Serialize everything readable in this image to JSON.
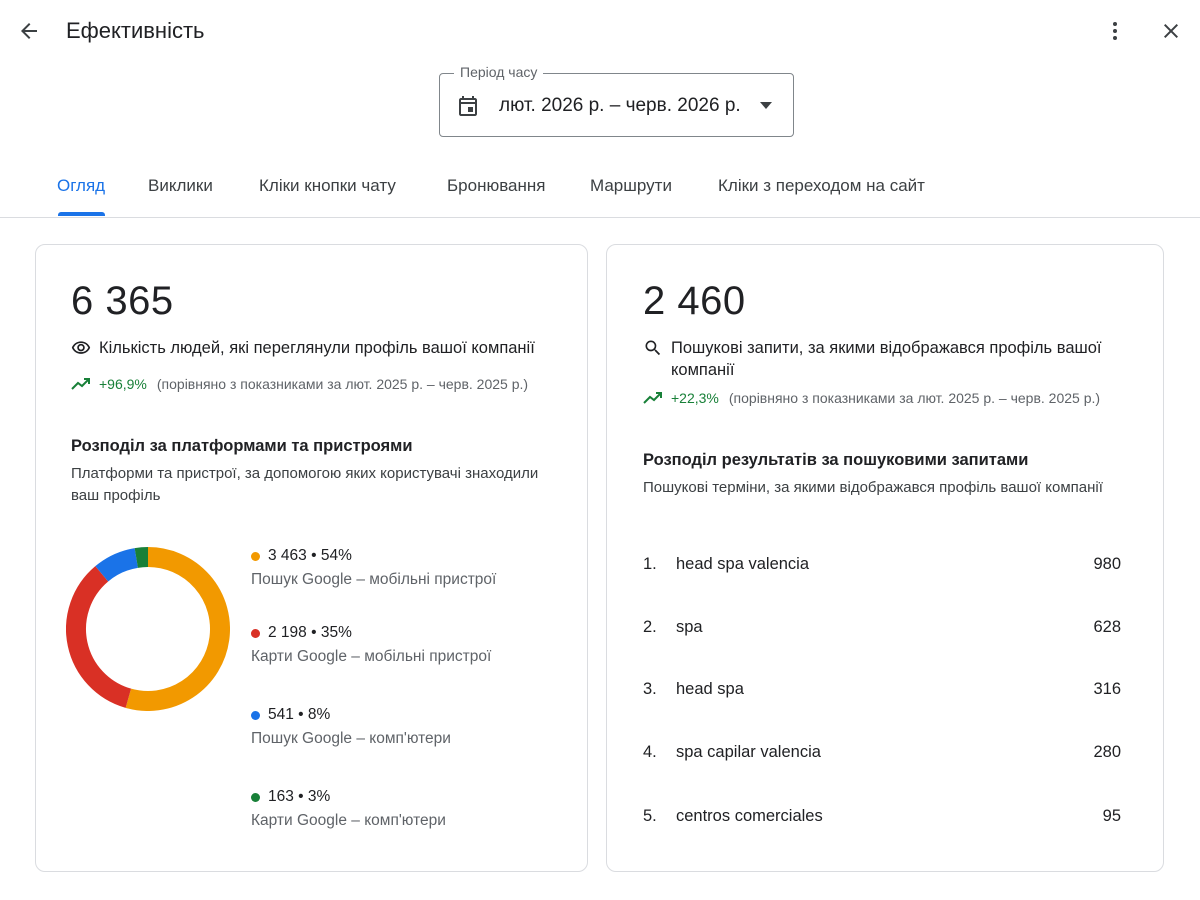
{
  "header": {
    "title": "Ефективність"
  },
  "period": {
    "label": "Період часу",
    "value": "лют. 2026 р. – черв. 2026 р."
  },
  "tabs": [
    {
      "label": "Огляд",
      "active": true
    },
    {
      "label": "Виклики"
    },
    {
      "label": "Кліки кнопки чату"
    },
    {
      "label": "Бронювання"
    },
    {
      "label": "Маршрути"
    },
    {
      "label": "Кліки з переходом на сайт"
    }
  ],
  "views_card": {
    "value": "6 365",
    "metric_label": "Кількість людей, які переглянули профіль вашої компанії",
    "metric_icon": "eye-icon",
    "trend_value": "+96,9%",
    "trend_note": "(порівняно з показниками за лют. 2025 р. – черв. 2025 р.)",
    "section_title": "Розподіл за платформами та пристроями",
    "section_sub": "Платформи та пристрої, за допомогою яких користувачі знаходили ваш профіль",
    "breakdown": [
      {
        "value": "3 463",
        "percent": "54%",
        "label": "Пошук Google – мобільні пристрої",
        "color": "#f29900",
        "share": 0.544
      },
      {
        "value": "2 198",
        "percent": "35%",
        "label": "Карти Google – мобільні пристрої",
        "color": "#d93025",
        "share": 0.345
      },
      {
        "value": "541",
        "percent": "8%",
        "label": "Пошук Google – комп'ютери",
        "color": "#1a73e8",
        "share": 0.085
      },
      {
        "value": "163",
        "percent": "3%",
        "label": "Карти Google – комп'ютери",
        "color": "#188038",
        "share": 0.026
      }
    ]
  },
  "search_card": {
    "value": "2 460",
    "metric_label": "Пошукові запити, за якими відображався профіль вашої компанії",
    "metric_icon": "search-icon",
    "trend_value": "+22,3%",
    "trend_note": "(порівняно з показниками за лют. 2025 р. – черв. 2025 р.)",
    "section_title": "Розподіл результатів за пошуковими запитами",
    "section_sub": "Пошукові терміни, за якими відображався профіль вашої компанії",
    "queries": [
      {
        "num": "1.",
        "term": "head spa valencia",
        "value": "980"
      },
      {
        "num": "2.",
        "term": "spa",
        "value": "628"
      },
      {
        "num": "3.",
        "term": "head spa",
        "value": "316"
      },
      {
        "num": "4.",
        "term": "spa capilar valencia",
        "value": "280"
      },
      {
        "num": "5.",
        "term": "centros comerciales",
        "value": "95"
      }
    ]
  },
  "colors": {
    "accent": "#1a73e8",
    "trend_up": "#188038"
  }
}
